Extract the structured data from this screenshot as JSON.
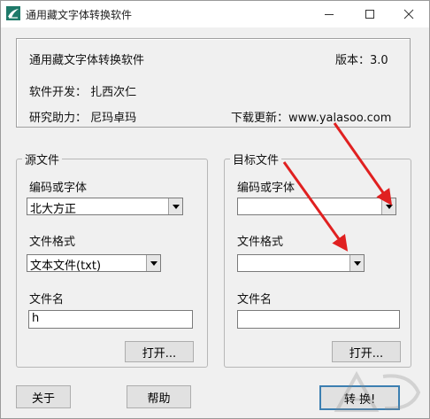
{
  "window": {
    "title": "通用藏文字体转换软件"
  },
  "info": {
    "app_name": "通用藏文字体转换软件",
    "version": "版本：3.0",
    "developer": "软件开发：  扎西次仁",
    "assistant": "研究助力：  尼玛卓玛",
    "update": "下载更新：www.yalasoo.com"
  },
  "source": {
    "legend": "源文件",
    "encoding_label": "编码或字体",
    "encoding_value": "北大方正",
    "format_label": "文件格式",
    "format_value": "文本文件(txt)",
    "filename_label": "文件名",
    "filename_value": "h",
    "open_button": "打开..."
  },
  "target": {
    "legend": "目标文件",
    "encoding_label": "编码或字体",
    "encoding_value": "",
    "format_label": "文件格式",
    "format_value": "",
    "filename_label": "文件名",
    "filename_value": "",
    "open_button": "打开..."
  },
  "footer": {
    "about_button": "关于",
    "help_button": "帮助",
    "convert_button": "转 换!"
  },
  "colors": {
    "annotation_arrow": "#e02020",
    "default_button_border": "#3c7fb1"
  }
}
